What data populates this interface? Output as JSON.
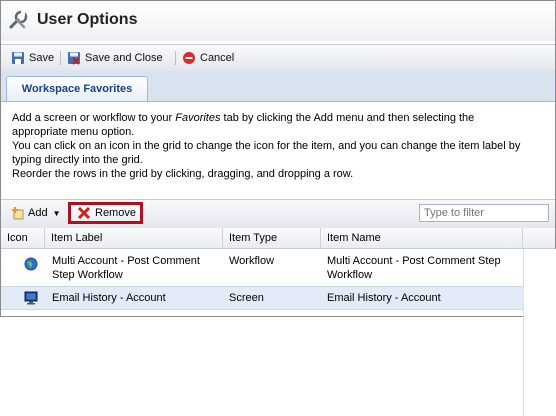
{
  "window": {
    "title": "User Options",
    "title_icon": "wrench-icon"
  },
  "toolbar": {
    "save_label": "Save",
    "save_close_label": "Save and Close",
    "cancel_label": "Cancel"
  },
  "tabs": [
    {
      "label": "Workspace Favorites"
    }
  ],
  "description": {
    "line1_pre": "Add a screen or workflow to your ",
    "line1_italic": "Favorites",
    "line1_post": " tab by clicking the Add menu and then selecting the",
    "line2": "appropriate menu option.",
    "line3": "You can click on an icon in the grid to change the icon for the item, and you can change the item label by",
    "line4": "typing directly into the grid.",
    "line5": "Reorder the rows in the grid by clicking, dragging, and dropping a row."
  },
  "grid_toolbar": {
    "add_label": "Add",
    "remove_label": "Remove",
    "filter_placeholder": "Type to filter"
  },
  "grid": {
    "columns": [
      "Icon",
      "Item Label",
      "Item Type",
      "Item Name"
    ],
    "rows": [
      {
        "icon": "globe-icon",
        "label_1": "Multi Account - Post Comment",
        "label_2": "Step Workflow",
        "type": "Workflow",
        "name_1": "Multi Account - Post Comment Step",
        "name_2": "Workflow"
      },
      {
        "icon": "monitor-icon",
        "label_1": "Email History - Account",
        "type": "Screen",
        "name_1": "Email History - Account"
      }
    ]
  },
  "colors": {
    "remove_highlight": "#b0121b",
    "tab_text": "#15428b",
    "selected_row": "#e2ebf7"
  }
}
